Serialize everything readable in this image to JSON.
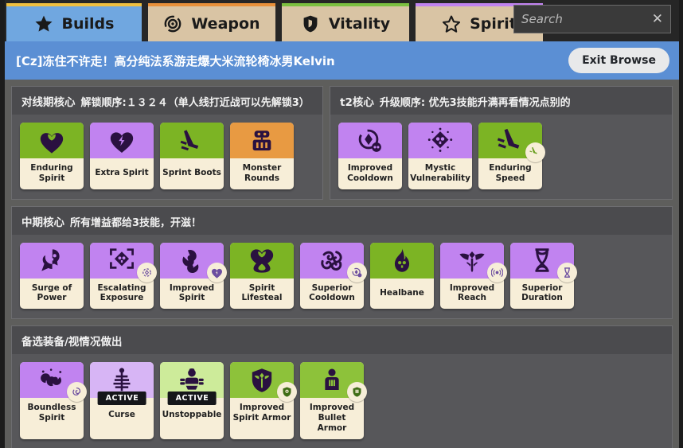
{
  "tabs": [
    {
      "label": "Builds",
      "icon": "star-filled-icon",
      "active": true
    },
    {
      "label": "Weapon",
      "icon": "target-ring-icon",
      "active": false
    },
    {
      "label": "Vitality",
      "icon": "shield-icon",
      "active": false
    },
    {
      "label": "Spirit",
      "icon": "star-outline-icon",
      "active": false
    }
  ],
  "search": {
    "placeholder": "Search",
    "value": "",
    "clear_label": "✕"
  },
  "header": {
    "build_title": "[Cz]冻住不许走！高分纯法系游走爆大米流轮椅冰男Kelvin",
    "exit_label": "Exit Browse"
  },
  "colors": {
    "accent_blue": "#5b8fd4",
    "tab_builds": "#70a7e0",
    "tab_inactive": "#d9c4a4",
    "green": "#7cb424",
    "purple": "#c183f0",
    "orange": "#e89a42",
    "light_green": "#cdeb9a",
    "light_purple": "#d7b5f5",
    "card_base": "#f7eed8",
    "panel_bg": "#57575a",
    "panel_head": "#4b4b4e",
    "page_bg": "#5e5e5c"
  },
  "sections": [
    {
      "id": "laning-core",
      "title": "对线期核心",
      "subtitle": "解锁顺序:１３２４（单人线打近战可以先解锁3）",
      "width": "left",
      "items": [
        {
          "name": "Enduring\nSpirit",
          "color": "green",
          "icon": "heart-leaf-icon",
          "badge": null,
          "active": false
        },
        {
          "name": "Extra Spirit",
          "color": "purple",
          "icon": "heart-bolt-icon",
          "badge": null,
          "active": false
        },
        {
          "name": "Sprint Boots",
          "color": "green",
          "icon": "boot-speed-icon",
          "badge": null,
          "active": false
        },
        {
          "name": "Monster\nRounds",
          "color": "orange",
          "icon": "robot-ammo-icon",
          "badge": null,
          "active": false
        }
      ]
    },
    {
      "id": "t2-core",
      "title": "t2核心",
      "subtitle": "升级顺序: 优先3技能升满再看情况点别的",
      "width": "right",
      "items": [
        {
          "name": "Improved\nCooldown",
          "color": "purple",
          "icon": "cooldown-cycle-icon",
          "badge": null,
          "active": false
        },
        {
          "name": "Mystic\nVulnerability",
          "color": "purple",
          "icon": "skull-burst-icon",
          "badge": null,
          "active": false
        },
        {
          "name": "Enduring\nSpeed",
          "color": "green",
          "icon": "boot-dash-icon",
          "badge": "speed-badge-icon",
          "active": false
        }
      ]
    },
    {
      "id": "mid-core",
      "title": "中期核心",
      "subtitle": "所有增益都给3技能，开滋！",
      "width": "full",
      "items": [
        {
          "name": "Surge of\nPower",
          "color": "purple",
          "icon": "ghost-skull-icon",
          "badge": null,
          "active": false
        },
        {
          "name": "Escalating\nExposure",
          "color": "purple",
          "icon": "target-skull-icon",
          "badge": "spirit-badge-icon",
          "active": false
        },
        {
          "name": "Improved\nSpirit",
          "color": "purple",
          "icon": "swirl-spirit-icon",
          "badge": "heart-badge-icon",
          "active": false
        },
        {
          "name": "Spirit\nLifesteal",
          "color": "green",
          "icon": "heart-hourglass-icon",
          "badge": null,
          "active": false
        },
        {
          "name": "Superior\nCooldown",
          "color": "purple",
          "icon": "tangle-swirl-icon",
          "badge": "cooldown-badge-icon",
          "active": false
        },
        {
          "name": "Healbane",
          "color": "green",
          "icon": "flame-skull-icon",
          "badge": null,
          "active": false
        },
        {
          "name": "Improved\nReach",
          "color": "purple",
          "icon": "wings-eye-icon",
          "badge": "range-badge-icon",
          "active": false
        },
        {
          "name": "Superior\nDuration",
          "color": "purple",
          "icon": "hourglass-icon",
          "badge": "hourglass-badge-icon",
          "active": false
        }
      ]
    },
    {
      "id": "situational",
      "title": "备选装备/视情况做出",
      "subtitle": "",
      "width": "full",
      "items": [
        {
          "name": "Boundless\nSpirit",
          "color": "purple",
          "icon": "spore-swirl-icon",
          "badge": "swirl-badge-icon",
          "active": false
        },
        {
          "name": "Curse",
          "color": "lpurple",
          "icon": "curse-totem-icon",
          "badge": null,
          "active": true,
          "active_label": "ACTIVE"
        },
        {
          "name": "Unstoppable",
          "color": "lgreen",
          "icon": "armored-arms-icon",
          "badge": null,
          "active": true,
          "active_label": "ACTIVE"
        },
        {
          "name": "Improved\nSpirit Armor",
          "color": "mgreen",
          "icon": "spirit-shield-icon",
          "badge": "spirit-armor-badge-icon",
          "active": false
        },
        {
          "name": "Improved\nBullet Armor",
          "color": "mgreen",
          "icon": "bullet-armor-icon",
          "badge": "bullet-armor-badge-icon",
          "active": false
        }
      ]
    }
  ]
}
